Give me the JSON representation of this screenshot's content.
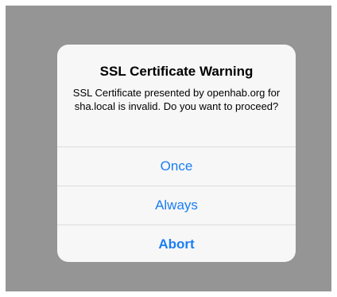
{
  "alert": {
    "title": "SSL Certificate Warning",
    "message": "SSL Certificate presented by openhab.org for sha.local is invalid. Do you want to proceed?",
    "buttons": [
      {
        "label": "Once"
      },
      {
        "label": "Always"
      },
      {
        "label": "Abort"
      }
    ]
  },
  "colors": {
    "backdrop": "#959595",
    "alert_background": "#f7f7f7",
    "button_text": "#1a7ef5",
    "separator": "#dcdcdc"
  }
}
